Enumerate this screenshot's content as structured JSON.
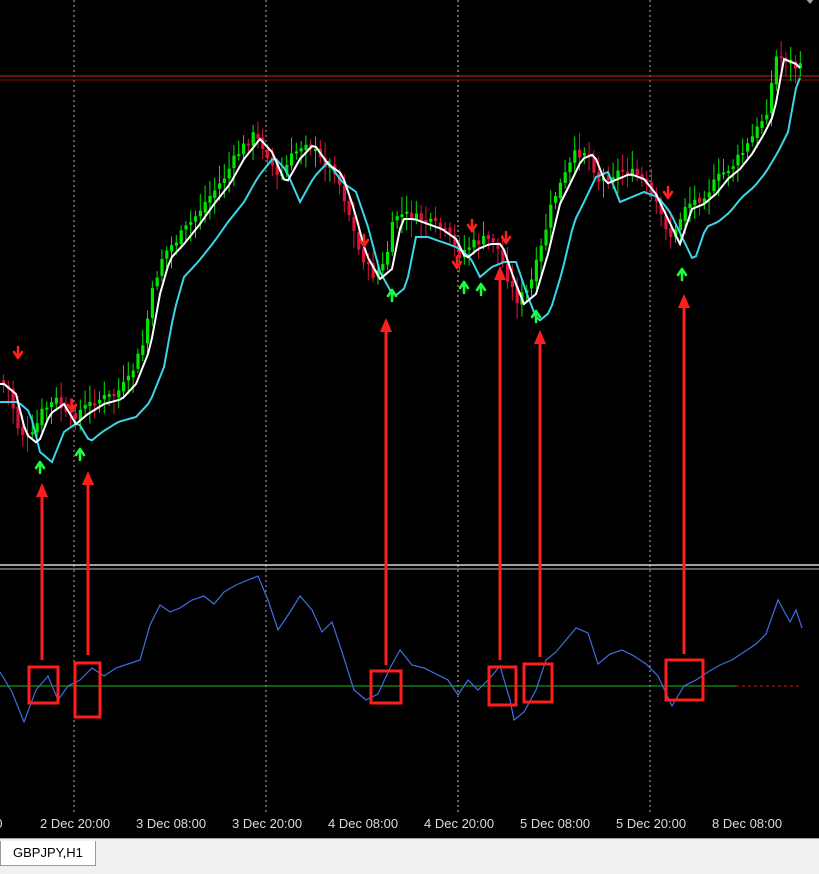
{
  "symbol_tab": "GBPJPY,H1",
  "colors": {
    "background": "#000000",
    "bull_candle": "#00e600",
    "bear_candle": "#dc143c",
    "fast_ma": "#ffffff",
    "slow_ma": "#3ad6e8",
    "indicator_line": "#3f6fe0",
    "zero_line": "#1fb81f",
    "resistance_line": "#c81e1e",
    "signal_up": "#19ff3c",
    "signal_down": "#ff2020",
    "annotation": "#ff1e1e",
    "grid": "#d0d0d0"
  },
  "time_axis": {
    "labels": [
      "00",
      "2 Dec 20:00",
      "3 Dec 08:00",
      "3 Dec 20:00",
      "4 Dec 08:00",
      "4 Dec 20:00",
      "5 Dec 08:00",
      "5 Dec 20:00",
      "8 Dec 08:00"
    ]
  },
  "annotations": {
    "count": 7,
    "style": "red box around indicator crossing with arrow pointing up to buy signal"
  },
  "chart_data": [
    {
      "type": "candlestick",
      "title": "",
      "series": [
        {
          "name": "",
          "values": []
        }
      ],
      "overlays": [
        "fast moving average",
        "slow moving average"
      ],
      "signals": {
        "buy_arrows": 12,
        "sell_arrows": 6
      },
      "horizontal_line": "resistance"
    },
    {
      "type": "line",
      "title": "",
      "series": [
        {
          "name": "",
          "values": []
        }
      ],
      "zero_line": true
    }
  ]
}
